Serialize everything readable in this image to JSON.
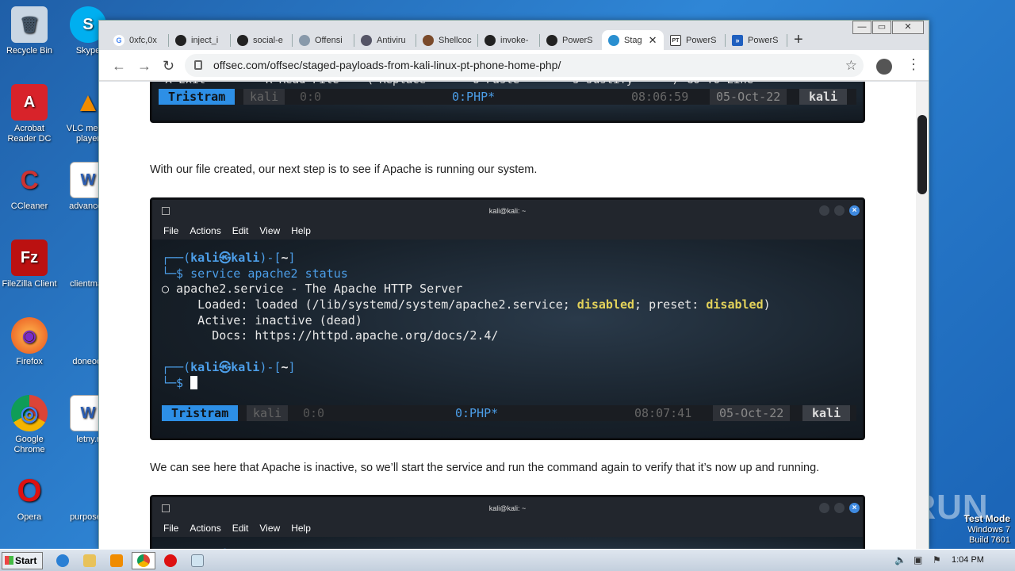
{
  "desktop": {
    "icons": [
      {
        "label": "Recycle Bin",
        "color": "#c9d6e3",
        "glyph": "🗑"
      },
      {
        "label": "Skype",
        "color": "#00aff0",
        "glyph": "S"
      },
      {
        "label": "Acrobat Reader DC",
        "label2": "Reader DC",
        "label1": "Acrobat",
        "color": "#d8232a",
        "glyph": "A"
      },
      {
        "label": "VLC media player",
        "label1": "VLC media",
        "label2": "player",
        "color": "#f08c00",
        "glyph": "▲"
      },
      {
        "label": "CCleaner",
        "color": "#c33",
        "glyph": "C"
      },
      {
        "label": "advanced",
        "color": "#2b5eb4",
        "glyph": "W"
      },
      {
        "label": "FileZilla Client",
        "color": "#b11",
        "glyph": "Fz"
      },
      {
        "label": "clientmail",
        "color": "#fff",
        "glyph": ""
      },
      {
        "label": "Firefox",
        "color": "#e86a1e",
        "glyph": "◉"
      },
      {
        "label": "doneoct",
        "color": "#fff",
        "glyph": ""
      },
      {
        "label": "Google Chrome",
        "label1": "Google",
        "label2": "Chrome",
        "color": "#3a9a3a",
        "glyph": "◎"
      },
      {
        "label": "letny.r",
        "color": "#2b5eb4",
        "glyph": "W"
      },
      {
        "label": "Opera",
        "color": "#d11",
        "glyph": "O"
      },
      {
        "label": "purposed",
        "color": "#fff",
        "glyph": ""
      }
    ]
  },
  "browser": {
    "tabs": [
      {
        "label": "0xfc,0x",
        "icon": "G",
        "color": "#4285f4"
      },
      {
        "label": "inject_i",
        "icon": "●",
        "color": "#222"
      },
      {
        "label": "social-e",
        "icon": "●",
        "color": "#222"
      },
      {
        "label": "Offensi",
        "icon": "◎",
        "color": "#556"
      },
      {
        "label": "Antiviru",
        "icon": "◎",
        "color": "#556"
      },
      {
        "label": "Shellcoc",
        "icon": "♣",
        "color": "#7a4a2a"
      },
      {
        "label": "invoke-",
        "icon": "●",
        "color": "#222"
      },
      {
        "label": "PowerS",
        "icon": "●",
        "color": "#222"
      },
      {
        "label": "Stag",
        "icon": "◐",
        "color": "#2a8fd0"
      },
      {
        "label": "PowerS",
        "icon": "PT",
        "color": "#333"
      },
      {
        "label": "PowerS",
        "icon": "»",
        "color": "#1f5fbf"
      }
    ],
    "active_tab_close": "✕",
    "new_tab": "+",
    "window_buttons": [
      "—",
      "▭",
      "✕"
    ],
    "url": "offsec.com/offsec/staged-payloads-from-kali-linux-pt-phone-home-php/",
    "back": "←",
    "forward": "→",
    "reload": "↻",
    "star": "☆",
    "menu": "⋮"
  },
  "page": {
    "top_term": {
      "menu_partial": "^X Exit        ^R Read File   ^\\ Replace      ^U Paste       ^J Justify     ^/ Go To Line",
      "tmux": {
        "session": "Tristram",
        "win": "kali",
        "pane": "0:0",
        "center": "0:PHP*",
        "time": "08:06:59",
        "date": "05-Oct-22",
        "host": "kali"
      }
    },
    "para1": "With our file created, our next step is to see if Apache is running our system.",
    "term1": {
      "title": "kali@kali: ~",
      "menu": [
        "File",
        "Actions",
        "Edit",
        "View",
        "Help"
      ],
      "prompt_user": "kali",
      "prompt_host": "kali",
      "prompt_dir": "~",
      "cmd": "service apache2 status",
      "l1": "○ apache2.service - The Apache HTTP Server",
      "l2a": "     Loaded: loaded (/lib/systemd/system/apache2.service; ",
      "l2b": "disabled",
      "l2c": "; preset: ",
      "l2d": "disabled",
      "l2e": ")",
      "l3": "     Active: inactive (dead)",
      "l4": "       Docs: https://httpd.apache.org/docs/2.4/",
      "tmux": {
        "session": "Tristram",
        "win": "kali",
        "pane": "0:0",
        "center": "0:PHP*",
        "time": "08:07:41",
        "date": "05-Oct-22",
        "host": "kali"
      }
    },
    "para2": "We can see here that Apache is inactive, so we’ll start the service and run the command again to verify that it’s now up and running.",
    "term2": {
      "title": "kali@kali: ~",
      "menu": [
        "File",
        "Actions",
        "Edit",
        "View",
        "Help"
      ]
    }
  },
  "watermark": "ANY RUN",
  "testmode": {
    "l1": "Test Mode",
    "l2": "Windows 7",
    "l3": "Build 7601"
  },
  "taskbar": {
    "start": "Start",
    "clock": "1:04 PM"
  }
}
